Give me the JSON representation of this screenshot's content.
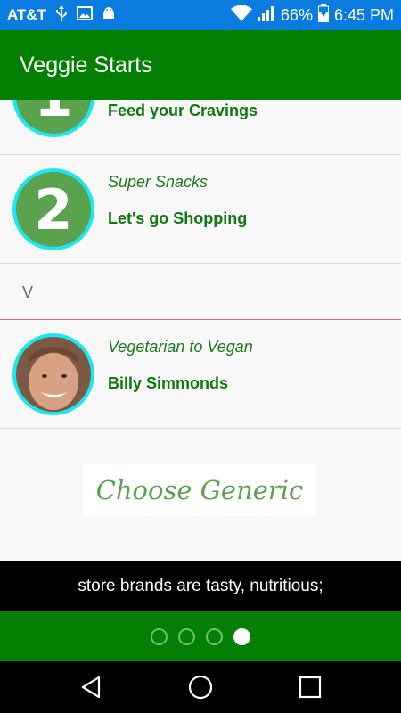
{
  "status_bar": {
    "carrier": "AT&T",
    "battery": "66%",
    "time": "6:45 PM",
    "icons": [
      "usb-icon",
      "image-icon",
      "android-icon",
      "wifi-icon",
      "signal-icon",
      "battery-icon"
    ]
  },
  "app_bar": {
    "title": "Veggie Starts"
  },
  "list": {
    "items": [
      {
        "number": "1",
        "subtitle": "",
        "title": "Feed your Cravings"
      },
      {
        "number": "2",
        "subtitle": "Super Snacks",
        "title": "Let's go Shopping"
      },
      {
        "subtitle": "Vegetarian to Vegan",
        "title": "Billy Simmonds"
      }
    ],
    "separator_label": "V"
  },
  "banner": {
    "text": "Choose Generic"
  },
  "caption": {
    "text": "store brands are tasty, nutritious;"
  },
  "pager": {
    "count": 4,
    "active_index": 3
  },
  "colors": {
    "status_bar": "#0a7ce0",
    "app_bar": "#038003",
    "accent_ring": "#19e8f0",
    "text_green": "#0d7a0d"
  }
}
